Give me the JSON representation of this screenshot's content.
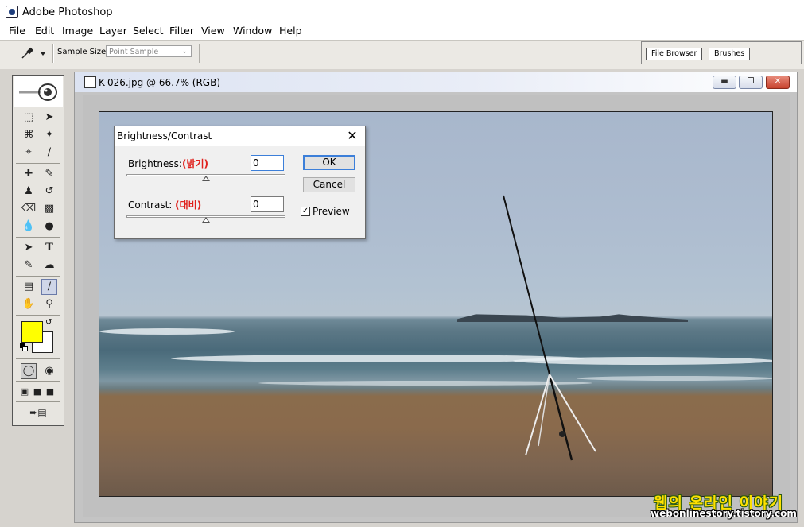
{
  "app": {
    "title": "Adobe Photoshop"
  },
  "menu": [
    "File",
    "Edit",
    "Image",
    "Layer",
    "Select",
    "Filter",
    "View",
    "Window",
    "Help"
  ],
  "options_bar": {
    "sample_size_label": "Sample Size:",
    "sample_size_value": "Point Sample",
    "palette_tabs": [
      "File Browser",
      "Brushes"
    ]
  },
  "document": {
    "title": "K-026.jpg @ 66.7% (RGB)",
    "buttons": [
      "minimize",
      "restore",
      "close"
    ]
  },
  "dialog": {
    "title": "Brightness/Contrast",
    "brightness_label": "Brightness:",
    "brightness_korean": "(밝기)",
    "brightness_value": "0",
    "contrast_label": "Contrast:",
    "contrast_korean": "(대비)",
    "contrast_value": "0",
    "brightness_slider": 0,
    "contrast_slider": 0,
    "ok_label": "OK",
    "cancel_label": "Cancel",
    "preview_label": "Preview",
    "preview_checked": true
  },
  "colors": {
    "foreground": "#ffff00",
    "background": "#ffffff"
  },
  "watermark": {
    "korean": "웹의 온라인 이야기",
    "url": "webonlinestory.tistory.com"
  }
}
